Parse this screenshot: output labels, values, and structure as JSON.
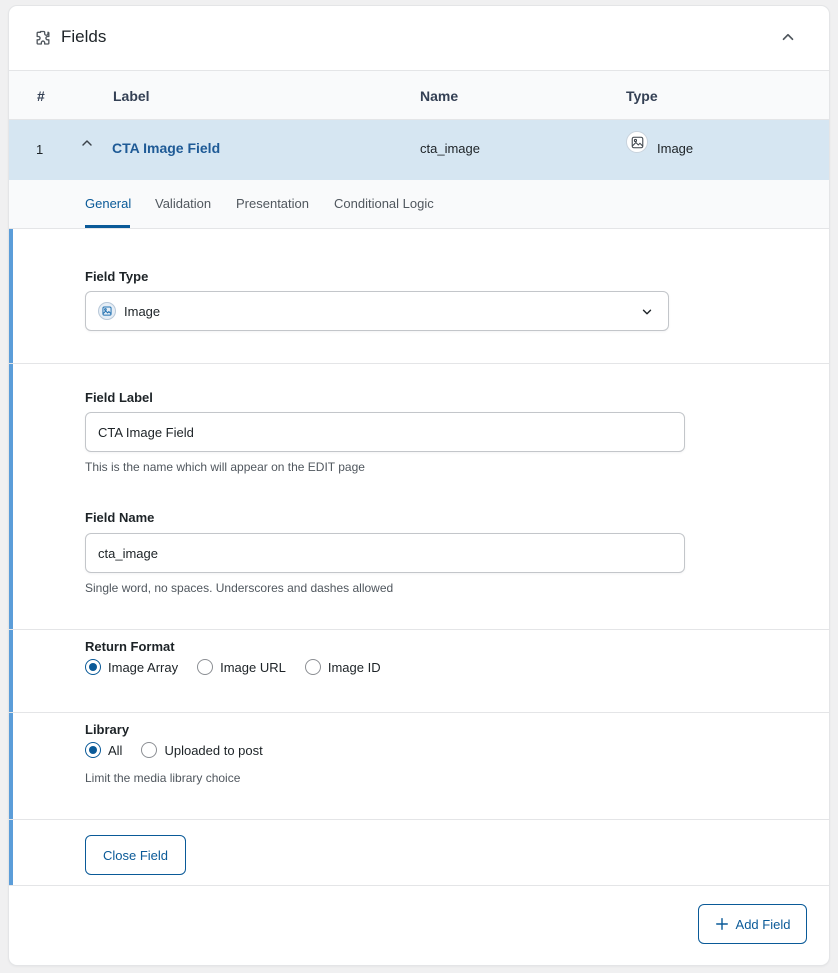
{
  "panel": {
    "title": "Fields",
    "icons": {
      "header": "puzzle-icon",
      "collapse": "chevron-up-icon"
    }
  },
  "columns": {
    "num": "#",
    "label": "Label",
    "name": "Name",
    "type": "Type"
  },
  "field_row": {
    "num": "1",
    "label": "CTA Image Field",
    "name": "cta_image",
    "type": "Image",
    "type_icon": "image-icon",
    "toggle_icon": "chevron-up-icon"
  },
  "tabs": [
    {
      "label": "General",
      "active": true
    },
    {
      "label": "Validation",
      "active": false
    },
    {
      "label": "Presentation",
      "active": false
    },
    {
      "label": "Conditional Logic",
      "active": false
    }
  ],
  "field_type": {
    "label": "Field Type",
    "value": "Image",
    "icon": "image-icon"
  },
  "field_label": {
    "label": "Field Label",
    "value": "CTA Image Field",
    "hint": "This is the name which will appear on the EDIT page"
  },
  "field_name": {
    "label": "Field Name",
    "value": "cta_image",
    "hint": "Single word, no spaces. Underscores and dashes allowed"
  },
  "return_format": {
    "label": "Return Format",
    "options": [
      {
        "label": "Image Array",
        "checked": true
      },
      {
        "label": "Image URL",
        "checked": false
      },
      {
        "label": "Image ID",
        "checked": false
      }
    ]
  },
  "library": {
    "label": "Library",
    "options": [
      {
        "label": "All",
        "checked": true
      },
      {
        "label": "Uploaded to post",
        "checked": false
      }
    ],
    "hint": "Limit the media library choice"
  },
  "buttons": {
    "close_field": "Close Field",
    "add_field": "Add Field"
  },
  "colors": {
    "accent": "#0a5a98",
    "row_highlight": "#d6e6f2",
    "left_border": "#5b9dd9"
  }
}
